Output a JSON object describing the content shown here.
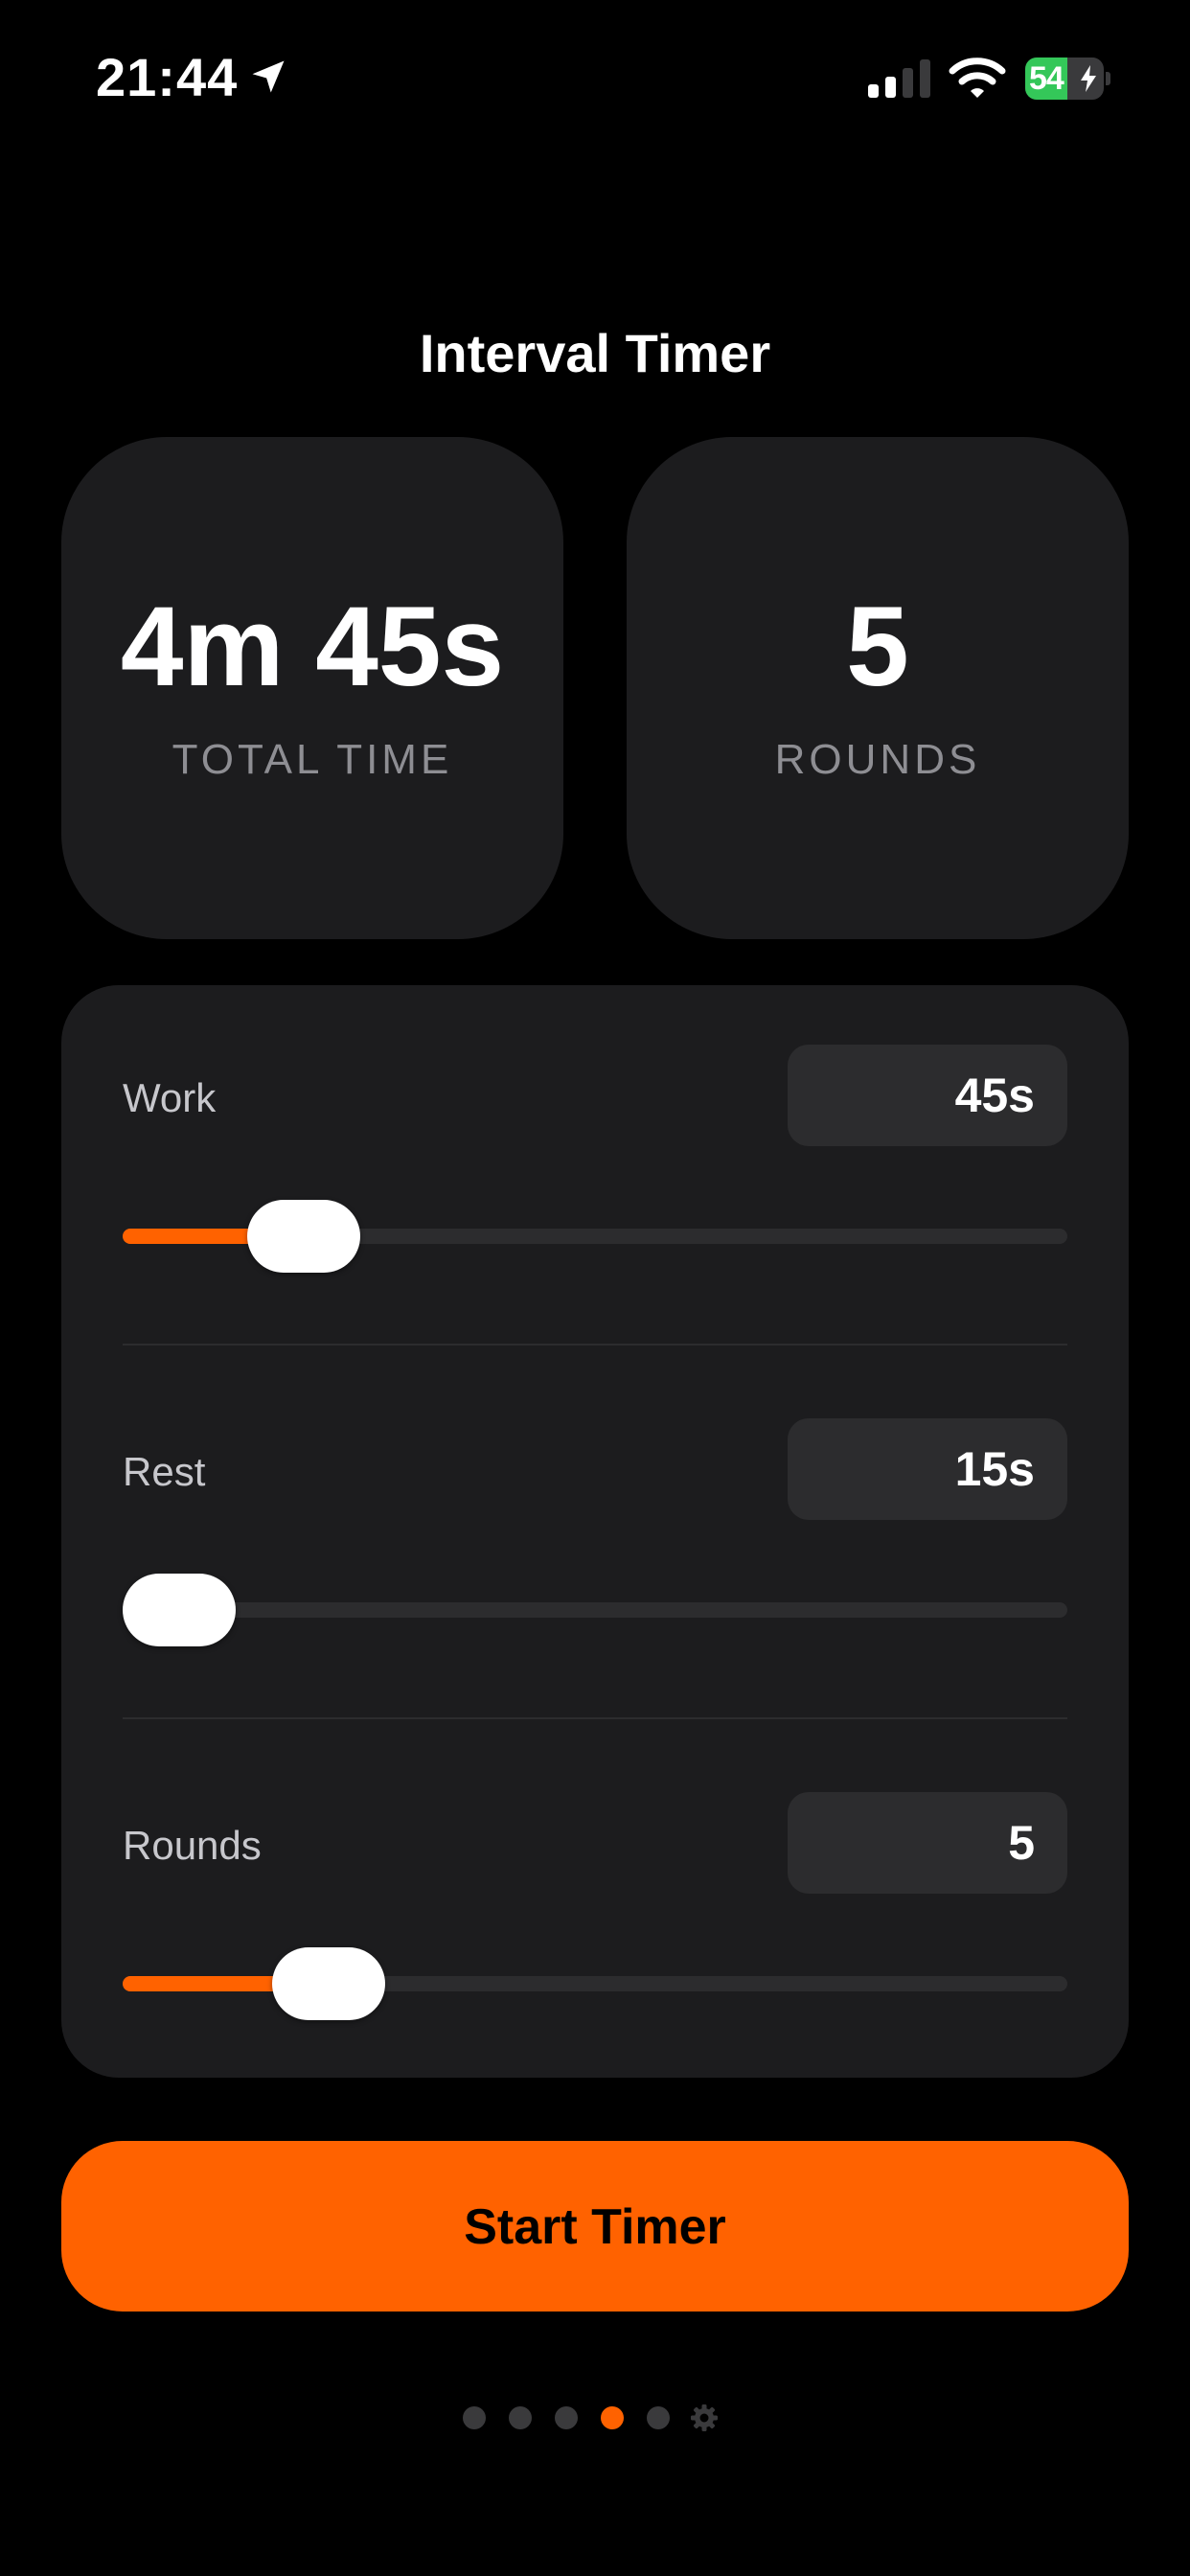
{
  "status_bar": {
    "time": "21:44",
    "battery_percent": "54",
    "battery_level": 0.54,
    "icons": [
      "location-arrow-icon",
      "cellular-signal-icon",
      "wifi-icon",
      "battery-charging-icon"
    ]
  },
  "header": {
    "title": "Interval Timer"
  },
  "summary": {
    "total_time_value": "4m 45s",
    "total_time_label": "TOTAL TIME",
    "rounds_value": "5",
    "rounds_label": "ROUNDS"
  },
  "settings": [
    {
      "key": "work",
      "label": "Work",
      "value": "45s",
      "slider_fraction": 0.15
    },
    {
      "key": "rest",
      "label": "Rest",
      "value": "15s",
      "slider_fraction": 0.0
    },
    {
      "key": "rounds",
      "label": "Rounds",
      "value": "5",
      "slider_fraction": 0.18
    }
  ],
  "actions": {
    "start_label": "Start Timer"
  },
  "page_indicator": {
    "pages": 5,
    "active_index": 3,
    "extra_icon": "gear-icon"
  },
  "colors": {
    "accent": "#ff6200",
    "background": "#000000",
    "card": "#1c1c1e",
    "field": "#2c2c2e",
    "label_muted": "#8e8e93",
    "battery_green": "#34c759"
  }
}
